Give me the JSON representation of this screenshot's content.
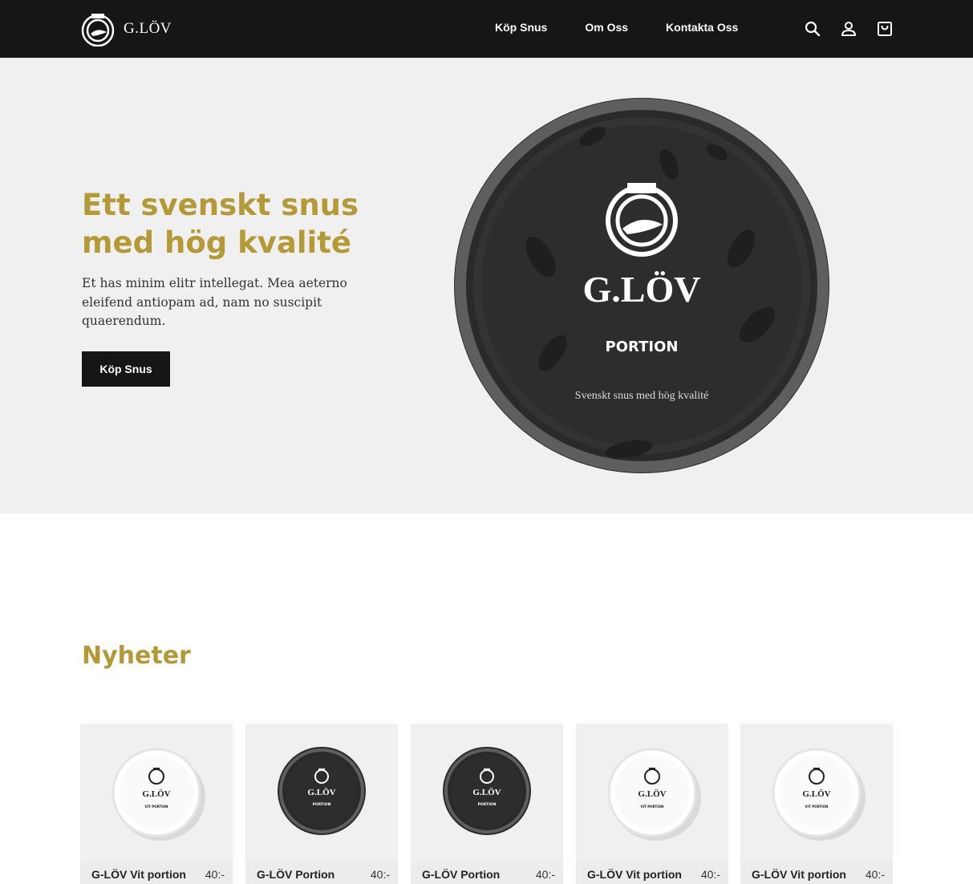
{
  "header": {
    "logo_text": "G.LÖV",
    "nav": [
      {
        "label": "Köp Snus"
      },
      {
        "label": "Om Oss"
      },
      {
        "label": "Kontakta Oss"
      }
    ],
    "icons": [
      "search-icon",
      "user-icon",
      "cart-icon"
    ]
  },
  "hero": {
    "title": "Ett svenskt snus med hög kvalité",
    "text": "Et has minim elitr intellegat. Mea aeterno eleifend antiopam ad, nam no suscipit quaerendum.",
    "button_label": "Köp Snus",
    "tin": {
      "brand": "G.LÖV",
      "subtitle": "PORTION",
      "tagline": "Svenskt snus med hög kvalité"
    }
  },
  "news": {
    "title": "Nyheter",
    "products": [
      {
        "name": "G-LÖV Vit portion",
        "price": "40:-",
        "variant": "white",
        "tin_brand": "G.LÖV",
        "tin_subtitle": "VIT PORTION"
      },
      {
        "name": "G-LÖV Portion",
        "price": "40:-",
        "variant": "dark",
        "tin_brand": "G.LÖV",
        "tin_subtitle": "PORTION"
      },
      {
        "name": "G-LÖV Portion",
        "price": "40:-",
        "variant": "dark",
        "tin_brand": "G.LÖV",
        "tin_subtitle": "PORTION"
      },
      {
        "name": "G-LÖV Vit portion",
        "price": "40:-",
        "variant": "white",
        "tin_brand": "G.LÖV",
        "tin_subtitle": "VIT PORTION"
      },
      {
        "name": "G-LÖV Vit portion",
        "price": "40:-",
        "variant": "white",
        "tin_brand": "G.LÖV",
        "tin_subtitle": "VIT PORTION"
      }
    ]
  },
  "colors": {
    "header_bg": "#161616",
    "hero_bg": "#f0f0f0",
    "accent_gold": "#b49a36",
    "button_bg": "#161616"
  }
}
